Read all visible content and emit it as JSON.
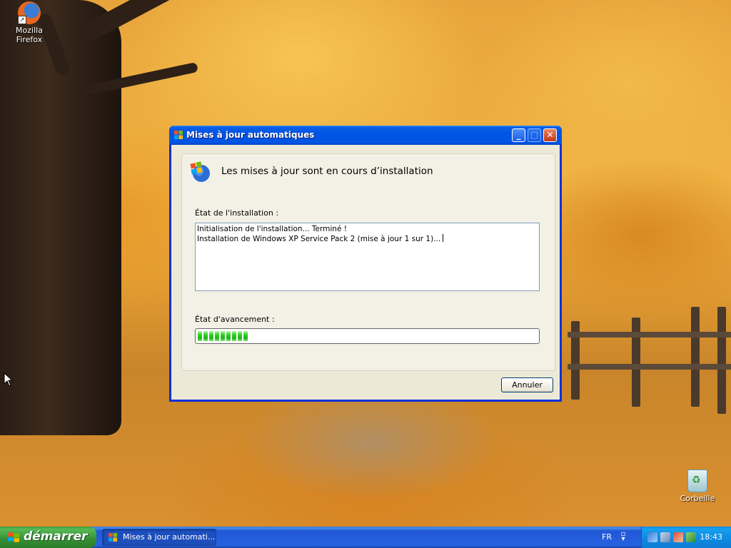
{
  "desktop": {
    "icons": {
      "firefox": "Mozilla Firefox",
      "recycle_bin": "Corbeille"
    }
  },
  "window": {
    "title": "Mises à jour automatiques",
    "heading": "Les mises à jour sont en cours d’installation",
    "status_label": "État de l'installation :",
    "log_lines": [
      "Initialisation de l'installation... Terminé !",
      "Installation de Windows XP Service Pack 2 (mise à jour 1 sur 1)..."
    ],
    "progress_label": "État d'avancement :",
    "progress_fraction": 0.16,
    "cancel_label": "Annuler",
    "controls": [
      "minimize-icon",
      "maximize-icon",
      "close-icon"
    ]
  },
  "taskbar": {
    "start_label": "démarrer",
    "task_item": "Mises à jour automati...",
    "language": "FR",
    "clock": "18:43"
  },
  "colors": {
    "titlebar": "#0054e3",
    "window_bg": "#ece9d8",
    "progress_green": "#37d12d",
    "start_green": "#379237",
    "taskbar_blue": "#2663e0",
    "tray_blue": "#0f8de3"
  }
}
